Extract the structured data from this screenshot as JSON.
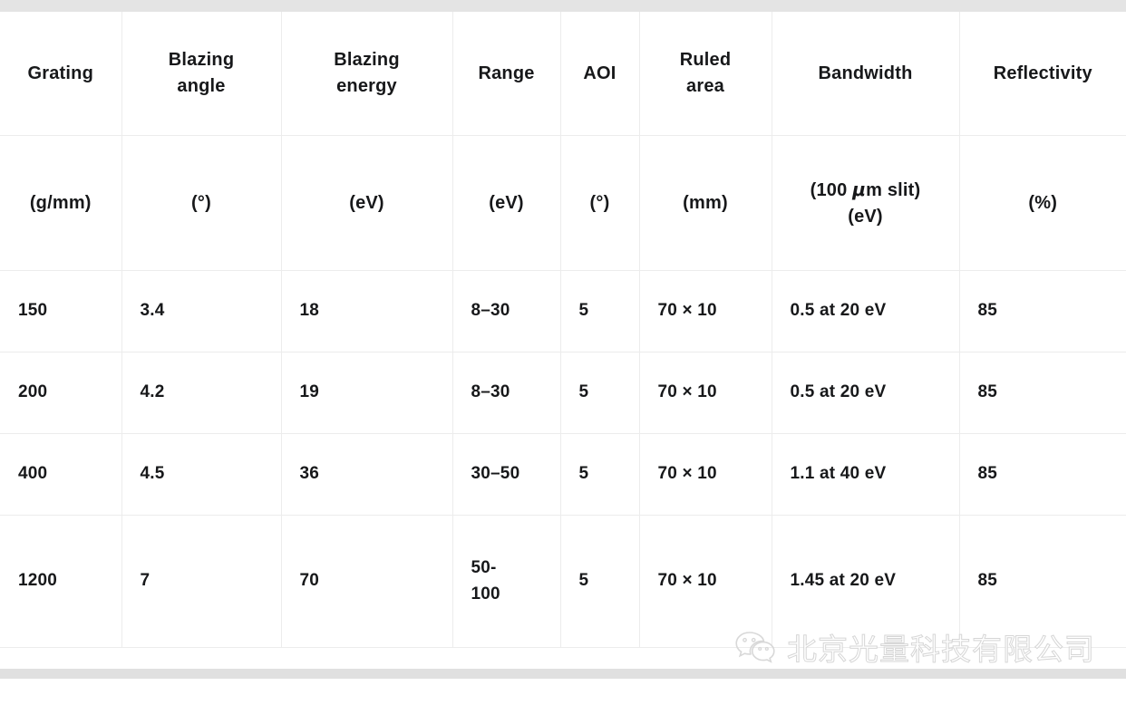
{
  "decor": {
    "top_bar_color": "#e4e4e4",
    "bottom_bar_color": "#e0e0e0",
    "border_color": "#ececec",
    "text_color": "#17181a"
  },
  "table": {
    "headers": [
      {
        "name": "Grating",
        "unit_lines": [
          "(g/mm)"
        ]
      },
      {
        "name": "Blazing angle",
        "name_lines": [
          "Blazing",
          "angle"
        ],
        "unit_lines": [
          "(°)"
        ]
      },
      {
        "name": "Blazing energy",
        "name_lines": [
          "Blazing",
          "energy"
        ],
        "unit_lines": [
          "(eV)"
        ]
      },
      {
        "name": "Range",
        "unit_lines": [
          "(eV)"
        ]
      },
      {
        "name": "AOI",
        "unit_lines": [
          "(°)"
        ]
      },
      {
        "name": "Ruled area",
        "name_lines": [
          "Ruled",
          "area"
        ],
        "unit_lines": [
          "(mm)"
        ]
      },
      {
        "name": "Bandwidth",
        "unit_lines": [
          "(100 μm slit)",
          "(eV)"
        ]
      },
      {
        "name": "Reflectivity",
        "unit_lines": [
          "(%)"
        ]
      }
    ],
    "rows": [
      {
        "grating": "150",
        "blazing_angle": "3.4",
        "blazing_energy": "18",
        "range": "8–30",
        "aoi": "5",
        "ruled_area": "70 × 10",
        "bandwidth": "0.5 at 20 eV",
        "reflectivity": "85"
      },
      {
        "grating": "200",
        "blazing_angle": "4.2",
        "blazing_energy": "19",
        "range": "8–30",
        "aoi": "5",
        "ruled_area": "70 × 10",
        "bandwidth": "0.5 at 20 eV",
        "reflectivity": "85"
      },
      {
        "grating": "400",
        "blazing_angle": "4.5",
        "blazing_energy": "36",
        "range": "30–50",
        "aoi": "5",
        "ruled_area": "70 × 10",
        "bandwidth": "1.1 at 40 eV",
        "reflectivity": "85"
      },
      {
        "grating": "1200",
        "blazing_angle": "7",
        "blazing_energy": "70",
        "range_lines": [
          "50-",
          "100"
        ],
        "range": "50–100",
        "aoi": "5",
        "ruled_area": "70 × 10",
        "bandwidth": "1.45 at 20 eV",
        "reflectivity": "85"
      }
    ]
  },
  "watermark": {
    "icon": "wechat-icon",
    "text": "北京光量科技有限公司"
  }
}
